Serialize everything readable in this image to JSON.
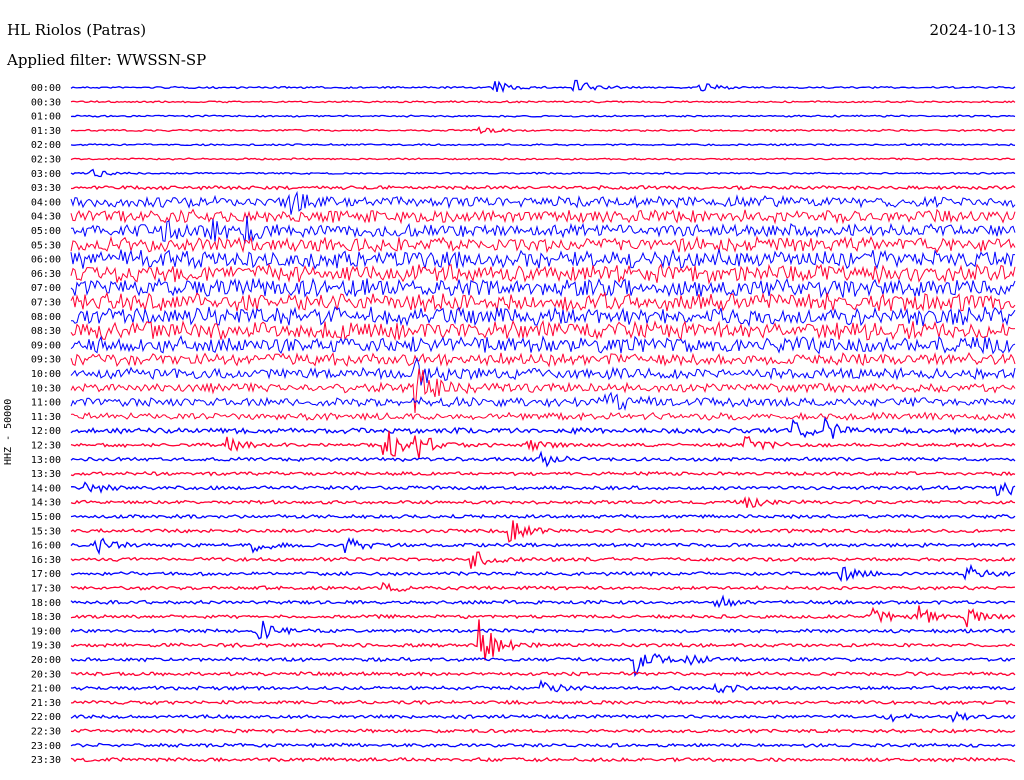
{
  "header": {
    "station": "HL Riolos (Patras)",
    "filter": "Applied filter: WWSSN-SP",
    "date": "2024-10-13"
  },
  "channel_label": "HHZ - 50000",
  "colors": {
    "blue": "#0000ff",
    "red": "#ff0033"
  },
  "chart_data": {
    "type": "line",
    "title": "HL Riolos (Patras)",
    "ylabel": "HHZ - 50000",
    "row_labels": [
      "00:00",
      "00:30",
      "01:00",
      "01:30",
      "02:00",
      "02:30",
      "03:00",
      "03:30",
      "04:00",
      "04:30",
      "05:00",
      "05:30",
      "06:00",
      "06:30",
      "07:00",
      "07:30",
      "08:00",
      "08:30",
      "09:00",
      "09:30",
      "10:00",
      "10:30",
      "11:00",
      "11:30",
      "12:00",
      "12:30",
      "13:00",
      "13:30",
      "14:00",
      "14:30",
      "15:00",
      "15:30",
      "16:00",
      "16:30",
      "17:00",
      "17:30",
      "18:00",
      "18:30",
      "19:00",
      "19:30",
      "20:00",
      "20:30",
      "21:00",
      "21:30",
      "22:00",
      "22:30",
      "23:00",
      "23:30"
    ],
    "noise_level": [
      1,
      1,
      1,
      1,
      1,
      1,
      1,
      2,
      6,
      7,
      7,
      8,
      10,
      10,
      10,
      10,
      10,
      10,
      9,
      7,
      6,
      5,
      5,
      4,
      3,
      2,
      2,
      2,
      2,
      2,
      2,
      2,
      2,
      2,
      2,
      2,
      2,
      2,
      2,
      2,
      2,
      2,
      2,
      2,
      2,
      2,
      2,
      2
    ],
    "events": [
      {
        "row": "00:00",
        "minute": 13.5,
        "amp": 6
      },
      {
        "row": "00:00",
        "minute": 16,
        "amp": 10
      },
      {
        "row": "00:00",
        "minute": 20,
        "amp": 5
      },
      {
        "row": "01:30",
        "minute": 13,
        "amp": 3
      },
      {
        "row": "03:00",
        "minute": 0.7,
        "amp": 4
      },
      {
        "row": "04:00",
        "minute": 7,
        "amp": 9
      },
      {
        "row": "05:00",
        "minute": 3,
        "amp": 10
      },
      {
        "row": "05:00",
        "minute": 4.5,
        "amp": 10
      },
      {
        "row": "05:00",
        "minute": 5.5,
        "amp": 10
      },
      {
        "row": "10:00",
        "minute": 11,
        "amp": 12
      },
      {
        "row": "10:30",
        "minute": 11,
        "amp": 26
      },
      {
        "row": "11:00",
        "minute": 17,
        "amp": 10
      },
      {
        "row": "12:00",
        "minute": 23,
        "amp": 8
      },
      {
        "row": "12:00",
        "minute": 24,
        "amp": 9
      },
      {
        "row": "12:30",
        "minute": 5,
        "amp": 7
      },
      {
        "row": "12:30",
        "minute": 10,
        "amp": 22
      },
      {
        "row": "12:30",
        "minute": 11,
        "amp": 12
      },
      {
        "row": "12:30",
        "minute": 14.5,
        "amp": 6
      },
      {
        "row": "12:30",
        "minute": 21.5,
        "amp": 8
      },
      {
        "row": "13:00",
        "minute": 15,
        "amp": 8
      },
      {
        "row": "14:00",
        "minute": 0.5,
        "amp": 6
      },
      {
        "row": "14:00",
        "minute": 29.5,
        "amp": 12
      },
      {
        "row": "14:30",
        "minute": 21.5,
        "amp": 5
      },
      {
        "row": "15:30",
        "minute": 14,
        "amp": 10
      },
      {
        "row": "16:00",
        "minute": 0.8,
        "amp": 8
      },
      {
        "row": "16:00",
        "minute": 5.8,
        "amp": 8
      },
      {
        "row": "16:00",
        "minute": 8.8,
        "amp": 7
      },
      {
        "row": "16:30",
        "minute": 12.8,
        "amp": 9
      },
      {
        "row": "17:00",
        "minute": 24.5,
        "amp": 7
      },
      {
        "row": "17:00",
        "minute": 28.5,
        "amp": 8
      },
      {
        "row": "17:30",
        "minute": 10,
        "amp": 6
      },
      {
        "row": "18:00",
        "minute": 20.5,
        "amp": 7
      },
      {
        "row": "18:30",
        "minute": 25.5,
        "amp": 7
      },
      {
        "row": "18:30",
        "minute": 27,
        "amp": 9
      },
      {
        "row": "18:30",
        "minute": 28.5,
        "amp": 9
      },
      {
        "row": "19:00",
        "minute": 6,
        "amp": 12
      },
      {
        "row": "19:30",
        "minute": 13,
        "amp": 28
      },
      {
        "row": "20:00",
        "minute": 18,
        "amp": 16
      },
      {
        "row": "20:00",
        "minute": 19.5,
        "amp": 6
      },
      {
        "row": "21:00",
        "minute": 15,
        "amp": 6
      },
      {
        "row": "21:00",
        "minute": 20.5,
        "amp": 7
      },
      {
        "row": "22:00",
        "minute": 26,
        "amp": 5
      },
      {
        "row": "22:00",
        "minute": 28,
        "amp": 4
      }
    ]
  }
}
